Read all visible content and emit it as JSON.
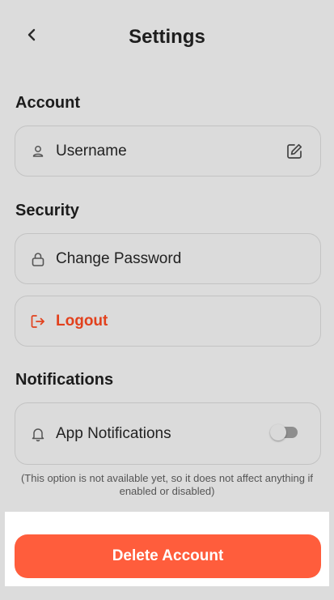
{
  "header": {
    "title": "Settings"
  },
  "sections": {
    "account": {
      "title": "Account",
      "username": {
        "label": "Username",
        "icon": "user-icon",
        "action_icon": "edit-icon"
      }
    },
    "security": {
      "title": "Security",
      "change_password": {
        "label": "Change Password",
        "icon": "lock-icon"
      },
      "logout": {
        "label": "Logout",
        "icon": "logout-icon"
      }
    },
    "notifications": {
      "title": "Notifications",
      "app_notifications": {
        "label": "App Notifications",
        "icon": "bell-icon",
        "enabled": false
      },
      "note": "(This option is not available yet, so it does not affect anything if enabled or disabled)"
    }
  },
  "footer": {
    "delete_label": "Delete Account"
  },
  "colors": {
    "accent": "#ff5d3c",
    "danger_text": "#e2411d",
    "background": "#dcdcdc"
  }
}
